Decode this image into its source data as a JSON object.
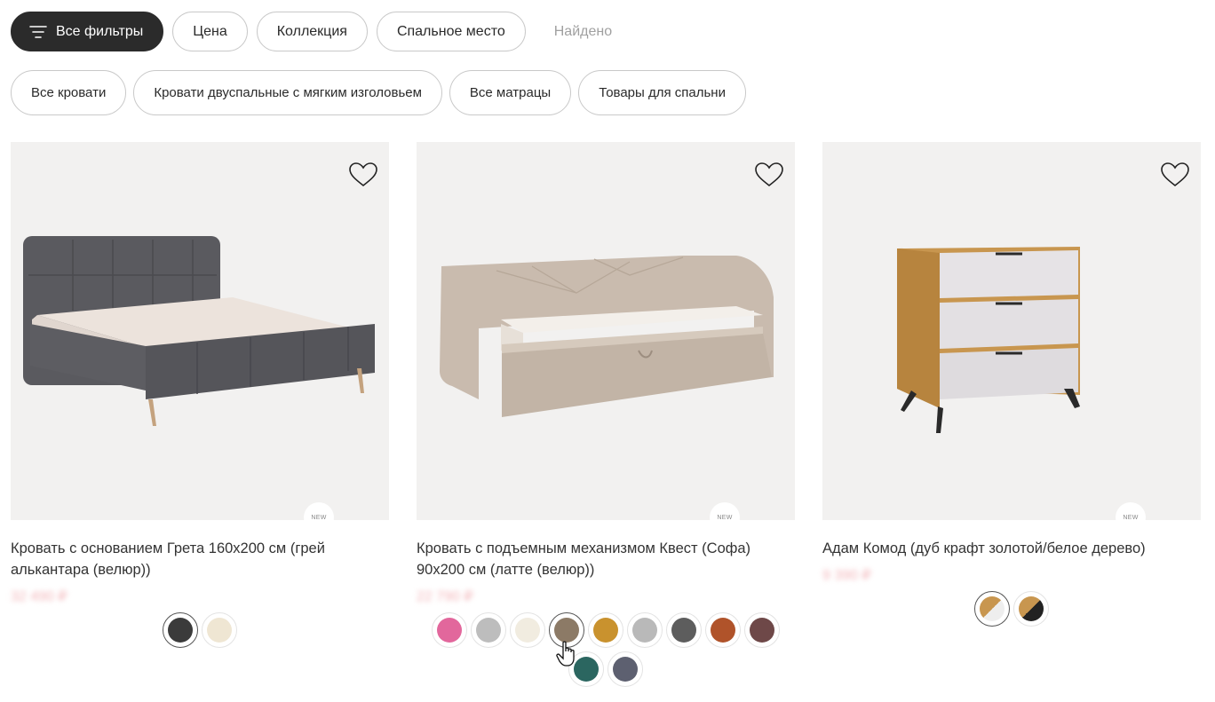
{
  "filters": {
    "all_filters_label": "Все фильтры",
    "chips": [
      "Цена",
      "Коллекция",
      "Спальное место"
    ],
    "found_label": "Найдено"
  },
  "categories": [
    "Все кровати",
    "Кровати двуспальные с мягким изголовьем",
    "Все матрацы",
    "Товары для спальни"
  ],
  "products": [
    {
      "title": "Кровать с основанием Грета 160х200 см (грей алькантара (велюр))",
      "price": "32 490 ₽",
      "badge": "NEW",
      "swatches": [
        "#3b3b3b",
        "#efe6d3"
      ]
    },
    {
      "title": "Кровать с подъемным механизмом Квест (Софа) 90х200 см (латте (велюр))",
      "price": "22 790 ₽",
      "badge": "NEW",
      "swatches": [
        "#e2679c",
        "#bdbdbd",
        "#f1ece0",
        "#8c7a66",
        "#c9922e",
        "#b9b9b9",
        "#5d5d5d",
        "#b0532a",
        "#6e4848",
        "#2b6660",
        "#5d6070"
      ]
    },
    {
      "title": "Адам Комод (дуб крафт золотой/белое дерево)",
      "price": "9 390 ₽",
      "badge": "NEW",
      "swatches": [
        "wood-white",
        "wood-black"
      ]
    }
  ]
}
